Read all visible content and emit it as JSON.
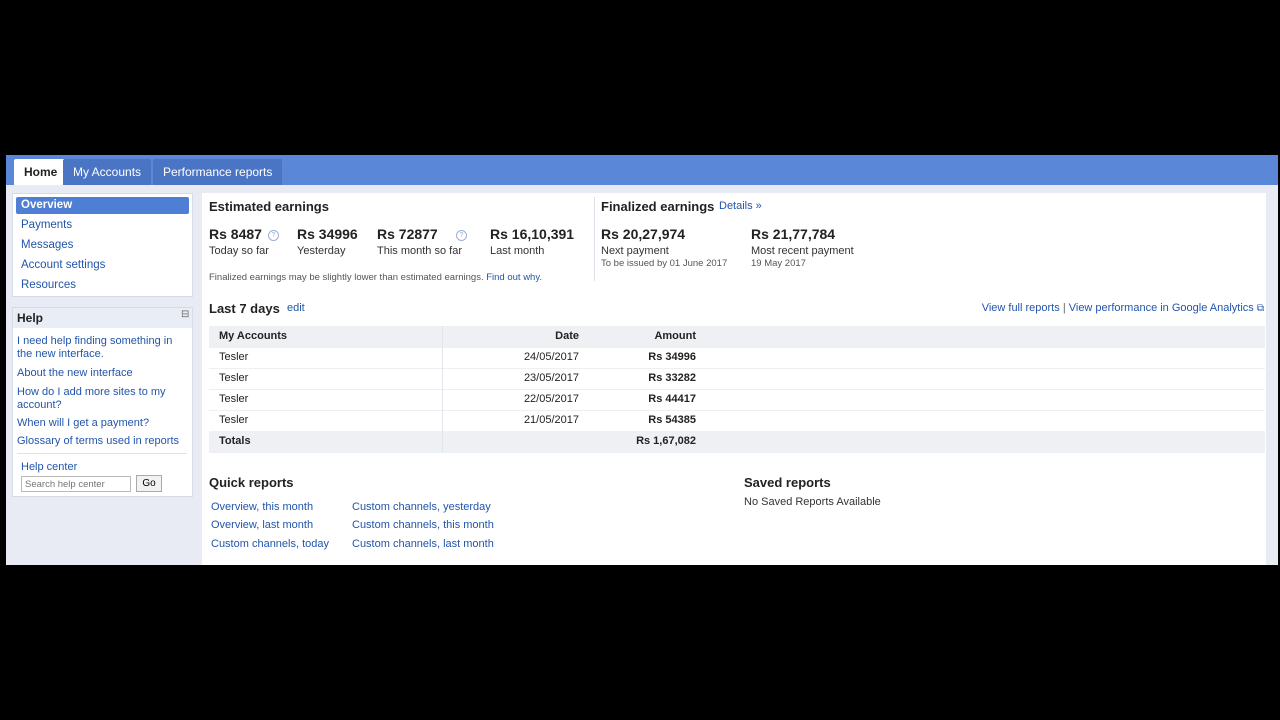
{
  "tabs": [
    {
      "label": "Home",
      "active": true
    },
    {
      "label": "My Accounts",
      "active": false
    },
    {
      "label": "Performance reports",
      "active": false
    }
  ],
  "nav": {
    "items": [
      {
        "label": "Overview",
        "active": true
      },
      {
        "label": "Payments"
      },
      {
        "label": "Messages"
      },
      {
        "label": "Account settings"
      },
      {
        "label": "Resources"
      }
    ]
  },
  "help": {
    "title": "Help",
    "collapse_glyph": "⊟",
    "links": [
      "I need help finding something in the new interface.",
      "About the new interface",
      "How do I add more sites to my account?",
      "When will I get a payment?",
      "Glossary of terms used in reports"
    ],
    "help_center": "Help center",
    "search_placeholder": "Search help center",
    "go_label": "Go"
  },
  "estimated": {
    "title": "Estimated earnings",
    "items": [
      {
        "value": "Rs 8487",
        "label": "Today so far",
        "info": true
      },
      {
        "value": "Rs 34996",
        "label": "Yesterday",
        "info": false
      },
      {
        "value": "Rs 72877",
        "label": "This month so far",
        "info": true
      },
      {
        "value": "Rs 16,10,391",
        "label": "Last month",
        "info": false
      }
    ],
    "note": "Finalized earnings may be slightly lower than estimated earnings.",
    "note_link": "Find out why."
  },
  "finalized": {
    "title": "Finalized earnings",
    "details_link": "Details »",
    "next_value": "Rs 20,27,974",
    "next_label": "Next payment",
    "next_sub": "To be issued by 01 June 2017",
    "recent_value": "Rs 21,77,784",
    "recent_label": "Most recent payment",
    "recent_sub": "19 May 2017"
  },
  "last7": {
    "title": "Last 7 days",
    "edit": "edit",
    "view_full": "View full reports",
    "separator": "|",
    "view_ga": "View performance in Google Analytics",
    "ext_icon": "⧉"
  },
  "table": {
    "headers": {
      "account": "My Accounts",
      "date": "Date",
      "amount": "Amount"
    },
    "rows": [
      {
        "account": "Tesler",
        "date": "24/05/2017",
        "amount": "Rs 34996"
      },
      {
        "account": "Tesler",
        "date": "23/05/2017",
        "amount": "Rs 33282"
      },
      {
        "account": "Tesler",
        "date": "22/05/2017",
        "amount": "Rs 44417"
      },
      {
        "account": "Tesler",
        "date": "21/05/2017",
        "amount": "Rs 54385"
      }
    ],
    "totals_label": "Totals",
    "totals_amount": "Rs 1,67,082"
  },
  "quick_reports": {
    "title": "Quick reports",
    "col1": [
      "Overview, this month",
      "Overview, last month",
      "Custom channels, today"
    ],
    "col2": [
      "Custom channels, yesterday",
      "Custom channels, this month",
      "Custom channels, last month"
    ]
  },
  "saved_reports": {
    "title": "Saved reports",
    "empty": "No Saved Reports Available"
  }
}
